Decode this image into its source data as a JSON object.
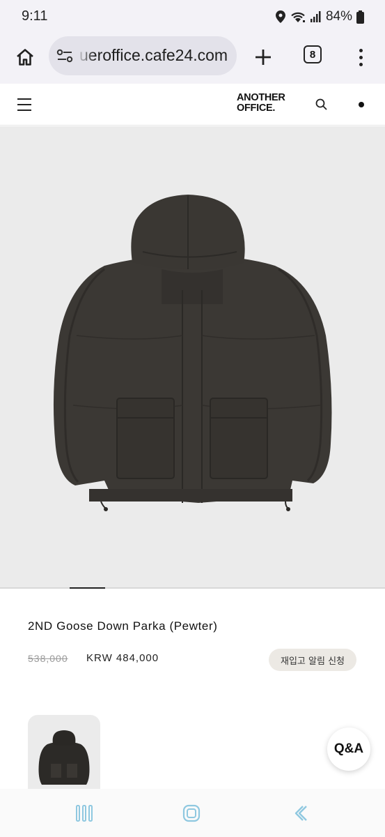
{
  "status_bar": {
    "time": "9:11",
    "battery": "84%",
    "icons": [
      "location-icon",
      "wifi-icon",
      "signal-icon",
      "battery-icon"
    ]
  },
  "browser": {
    "url": "ueroffice.cafe24.com",
    "tab_count": "8",
    "icons": [
      "home-icon",
      "site-settings-icon",
      "new-tab-icon",
      "more-icon"
    ]
  },
  "site_header": {
    "logo_line1": "ANOTHER",
    "logo_line2": "OFFICE.",
    "icons": [
      "hamburger-menu-icon",
      "search-icon",
      "dot-icon"
    ]
  },
  "product": {
    "title": "2ND Goose Down Parka (Pewter)",
    "original_price": "538,000",
    "sale_price": "KRW 484,000",
    "restock_button": "재입고 알림 신청",
    "image_subject": "dark-grey-hooded-down-parka"
  },
  "qa_button": "Q&A",
  "system_nav": {
    "icons": [
      "recent-apps-icon",
      "home-icon",
      "back-icon"
    ]
  },
  "colors": {
    "browser_bar": "#f3f2f7",
    "url_pill": "#e3e2ea",
    "image_bg": "#ebebeb",
    "restock_bg": "#ece9e4",
    "nav_icon": "#8fc8e0"
  }
}
